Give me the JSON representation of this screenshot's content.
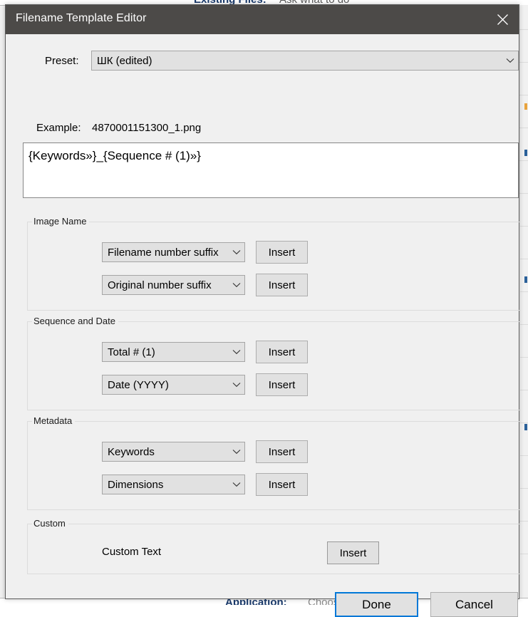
{
  "background": {
    "top_label": "Existing Files:",
    "top_value": "Ask what to do",
    "bottom_label": "Application:",
    "bottom_value": "Choose an application"
  },
  "dialog": {
    "title": "Filename Template Editor",
    "close_icon": "close-icon",
    "preset": {
      "label": "Preset:",
      "value": "ШК (edited)",
      "arrow_icon": "chevron-down-icon"
    },
    "example": {
      "label": "Example:",
      "value": "4870001151300_1.png"
    },
    "template": {
      "value": "{Keywords»}_{Sequence # (1)»}"
    },
    "groups": [
      {
        "title": "Image Name",
        "rows": [
          {
            "combo_value": "Filename number suffix",
            "insert_label": "Insert"
          },
          {
            "combo_value": "Original number suffix",
            "insert_label": "Insert"
          }
        ]
      },
      {
        "title": "Sequence and Date",
        "rows": [
          {
            "combo_value": "Total # (1)",
            "insert_label": "Insert"
          },
          {
            "combo_value": "Date (YYYY)",
            "insert_label": "Insert"
          }
        ]
      },
      {
        "title": "Metadata",
        "rows": [
          {
            "combo_value": "Keywords",
            "insert_label": "Insert"
          },
          {
            "combo_value": "Dimensions",
            "insert_label": "Insert"
          }
        ]
      }
    ],
    "custom": {
      "title": "Custom",
      "text_label": "Custom Text",
      "insert_label": "Insert"
    },
    "footer": {
      "done_label": "Done",
      "cancel_label": "Cancel",
      "accent_color": "#0078d7"
    }
  }
}
